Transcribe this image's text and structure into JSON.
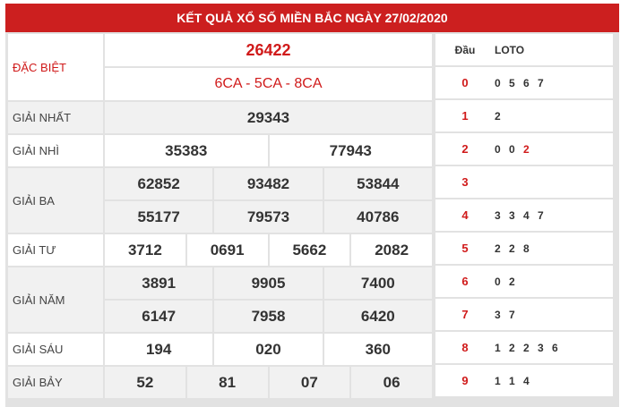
{
  "title": "KẾT QUẢ XỔ SỐ MIỀN BẮC NGÀY 27/02/2020",
  "prizes": {
    "special": {
      "label": "ĐẶC BIỆT",
      "number": "26422",
      "codes": "6CA - 5CA - 8CA"
    },
    "first": {
      "label": "GIẢI NHẤT",
      "numbers": [
        "29343"
      ]
    },
    "second": {
      "label": "GIẢI NHÌ",
      "numbers": [
        "35383",
        "77943"
      ]
    },
    "third": {
      "label": "GIẢI BA",
      "numbers": [
        "62852",
        "93482",
        "53844",
        "55177",
        "79573",
        "40786"
      ]
    },
    "fourth": {
      "label": "GIẢI TƯ",
      "numbers": [
        "3712",
        "0691",
        "5662",
        "2082"
      ]
    },
    "fifth": {
      "label": "GIẢI NĂM",
      "numbers": [
        "3891",
        "9905",
        "7400",
        "6147",
        "7958",
        "6420"
      ]
    },
    "sixth": {
      "label": "GIẢI SÁU",
      "numbers": [
        "194",
        "020",
        "360"
      ]
    },
    "seventh": {
      "label": "GIẢI BẢY",
      "numbers": [
        "52",
        "81",
        "07",
        "06"
      ]
    }
  },
  "loto": {
    "head_label": "Đầu",
    "loto_label": "LOTO",
    "rows": [
      {
        "dau": "0",
        "loto": "0 5 6 7"
      },
      {
        "dau": "1",
        "loto": "2"
      },
      {
        "dau": "2",
        "loto": "0 0",
        "loto_red": "2"
      },
      {
        "dau": "3",
        "loto": ""
      },
      {
        "dau": "4",
        "loto": "3 3 4 7"
      },
      {
        "dau": "5",
        "loto": "2 2 8"
      },
      {
        "dau": "6",
        "loto": "0 2"
      },
      {
        "dau": "7",
        "loto": "3 7"
      },
      {
        "dau": "8",
        "loto": "1 2 2 3 6"
      },
      {
        "dau": "9",
        "loto": "1 1 4"
      }
    ]
  },
  "colors": {
    "header_bg": "#cc1f1f",
    "accent_red": "#d01a1a",
    "grid": "#e2e2e2",
    "alt_row": "#f1f1f1"
  }
}
